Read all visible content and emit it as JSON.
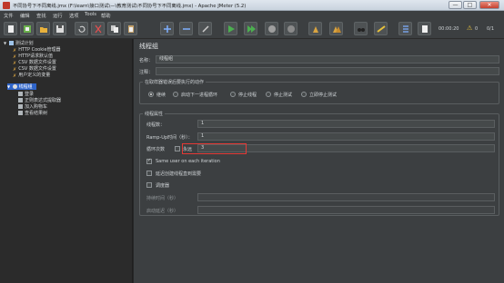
{
  "window": {
    "title": "不同协号下不同离线.jmx (F:\\learn\\接口测试\\—\\教育测试\\不同协号下不同离线.jmx) - Apache JMeter (5.2)",
    "min": "—",
    "max": "□",
    "close": "✕"
  },
  "menu": [
    "文件",
    "编辑",
    "查找",
    "运行",
    "选项",
    "Tools",
    "帮助"
  ],
  "toolbar": {
    "timer": "00:00:20",
    "warnings": "0",
    "threads": "0/1"
  },
  "tree": [
    {
      "label": "测试计划",
      "level": 0,
      "icon": "test-plan-icon"
    },
    {
      "label": "HTTP Cookie管理器",
      "level": 1,
      "icon": "wrench-icon"
    },
    {
      "label": "HTTP请求默认值",
      "level": 1,
      "icon": "wrench-icon"
    },
    {
      "label": "CSV 数据文件设置",
      "level": 1,
      "icon": "wrench-icon"
    },
    {
      "label": "CSV 数据文件设置",
      "level": 1,
      "icon": "wrench-icon"
    },
    {
      "label": "用户定义的变量",
      "level": 1,
      "icon": "wrench-icon"
    },
    {
      "label": "线程组",
      "level": 1,
      "icon": "gear-icon",
      "selected": true
    },
    {
      "label": "登录",
      "level": 2,
      "icon": "pencil-icon"
    },
    {
      "label": "正则表达式提取器",
      "level": 2,
      "icon": "pencil-icon"
    },
    {
      "label": "加入购物车",
      "level": 2,
      "icon": "pencil-icon"
    },
    {
      "label": "查看结果树",
      "level": 2,
      "icon": "pencil-icon"
    }
  ],
  "panel": {
    "heading": "线程组",
    "name_label": "名称：",
    "name_value": "线程组",
    "comment_label": "注释：",
    "comment_value": "",
    "sampler_error": {
      "title": "在取样器错误后要执行的动作",
      "options": [
        "继续",
        "启动下一进程循环",
        "停止线程",
        "停止测试",
        "立即停止测试"
      ],
      "selected": 0
    },
    "thread_props": {
      "title": "线程属性",
      "threads_label": "线程数：",
      "threads_value": "1",
      "rampup_label": "Ramp-Up时间（秒）：",
      "rampup_value": "1",
      "loop_label": "循环次数",
      "forever_label": "永远",
      "loop_value": "3",
      "same_user_label": "Same user on each iteration",
      "delay_label": "延迟创建线程直到需要",
      "scheduler_label": "调度器",
      "duration_label": "持续时间（秒）",
      "startup_delay_label": "启动延迟（秒）"
    }
  },
  "colors": {
    "selected_tree": "#2f65ca",
    "highlight": "#e53935"
  }
}
